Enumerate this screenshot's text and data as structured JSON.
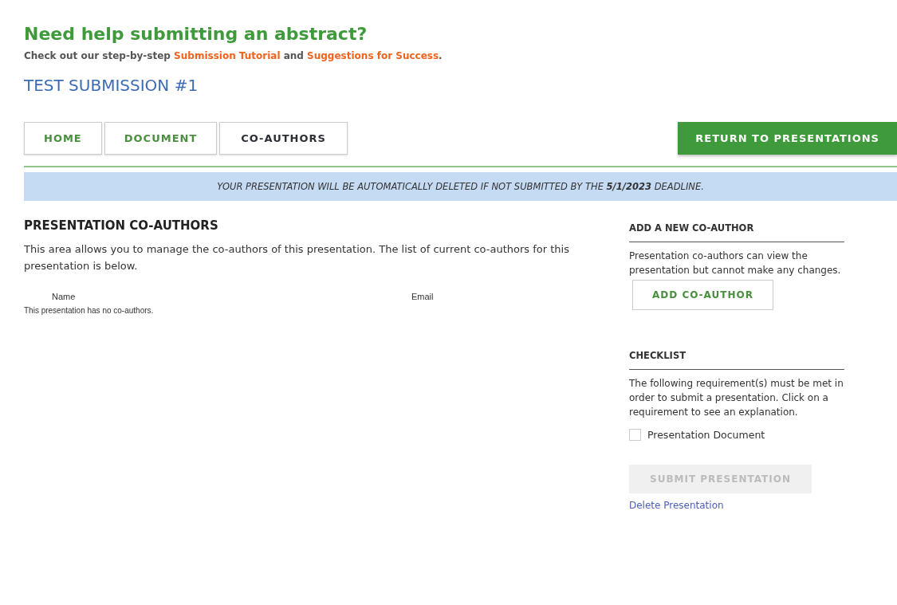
{
  "help": {
    "title": "Need help submitting an abstract?",
    "text": "Check out our step-by-step **Submission Tutorial** and **Suggestions for Success**."
  },
  "submission_title": "TEST SUBMISSION #1",
  "tabs": [
    {
      "label": "HOME",
      "selected": false
    },
    {
      "label": "DOCUMENT",
      "selected": false
    },
    {
      "label": "CO-AUTHORS",
      "selected": true
    }
  ],
  "return_button": "RETURN TO PRESENTATIONS",
  "notice": "YOUR PRESENTATION WILL BE AUTOMATICALLY DELETED IF NOT SUBMITTED BY THE **5/1/2023** DEADLINE.",
  "coauthors": {
    "title": "PRESENTATION CO-AUTHORS",
    "description": "This area allows you to manage the co-authors of this presentation. The list of current co-authors for this presentation is below.",
    "columns": [
      "Name",
      "Email"
    ],
    "empty_message": "This presentation has no co-authors."
  },
  "add_coauthor": {
    "title": "ADD A NEW CO-AUTHOR",
    "text": "Presentation co-authors can view the presentation but cannot make any changes.",
    "button": "ADD CO-AUTHOR"
  },
  "checklist": {
    "title": "CHECKLIST",
    "text": "The following requirement(s) must be met in order to submit a presentation. Click on a requirement to see an explanation.",
    "items": [
      {
        "label": "Presentation Document",
        "checked": false
      }
    ]
  },
  "submit_button": {
    "label": "SUBMIT PRESENTATION",
    "disabled": true
  },
  "delete_link": "Delete Presentation"
}
